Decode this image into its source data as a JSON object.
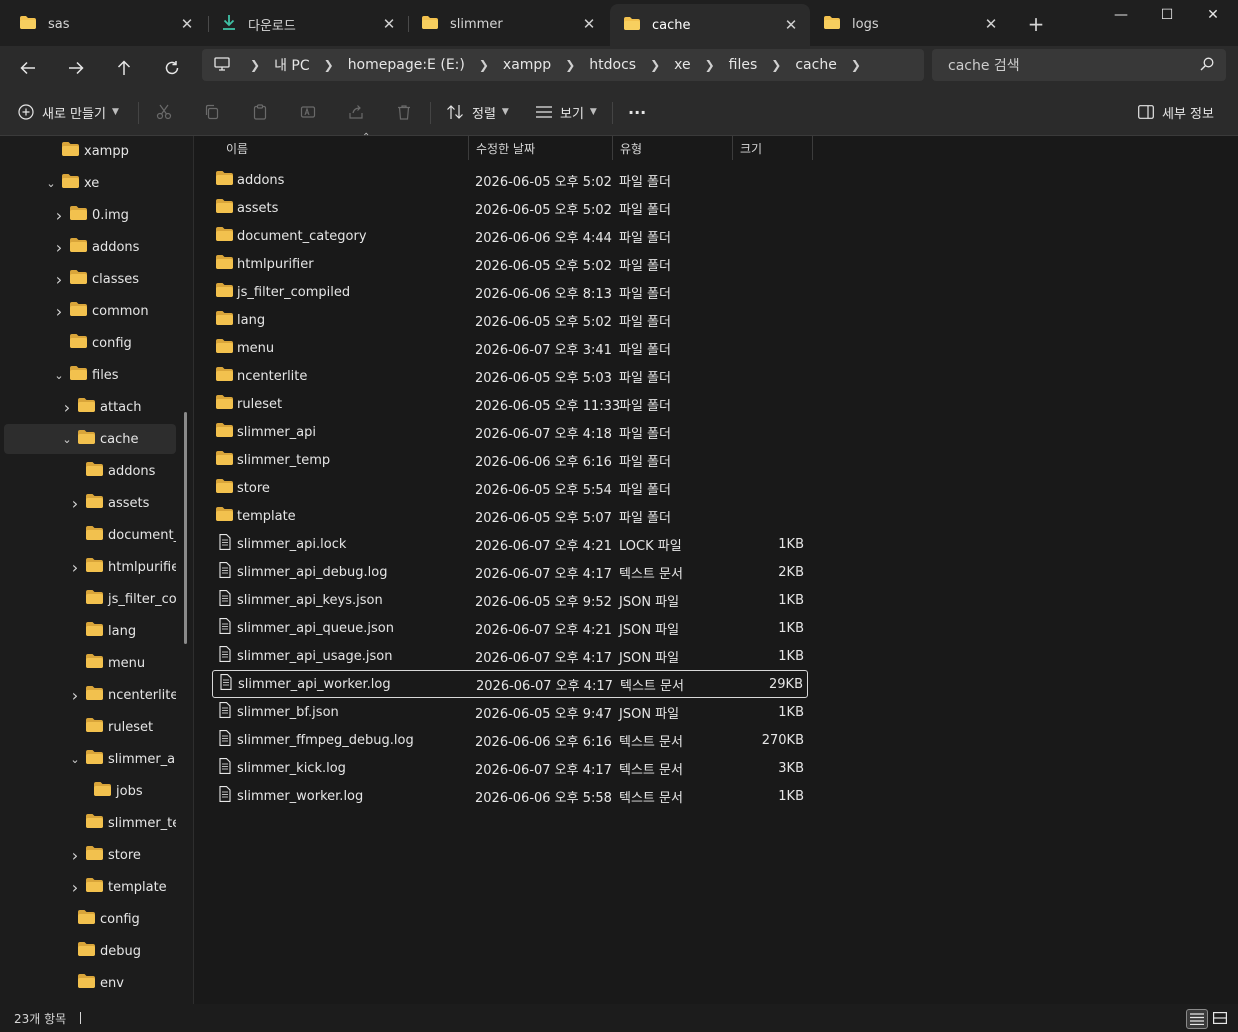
{
  "tabs": [
    {
      "label": "sas",
      "icon": "folder-icon"
    },
    {
      "label": "다운로드",
      "icon": "download-icon"
    },
    {
      "label": "slimmer",
      "icon": "folder-icon"
    },
    {
      "label": "cache",
      "icon": "folder-icon",
      "active": true
    },
    {
      "label": "logs",
      "icon": "folder-icon"
    }
  ],
  "tab_close_glyph": "✕",
  "new_tab_glyph": "+",
  "window_controls": {
    "minimize": "—",
    "maximize": "☐",
    "close": "✕"
  },
  "breadcrumb": [
    "내 PC",
    "homepage:E (E:)",
    "xampp",
    "htdocs",
    "xe",
    "files",
    "cache"
  ],
  "search": {
    "placeholder": "cache 검색"
  },
  "commands": {
    "new": "새로 만들기",
    "sort": "정렬",
    "view": "보기",
    "more": "···",
    "details": "세부 정보"
  },
  "columns": {
    "name": "이름",
    "date": "수정한 날짜",
    "type": "유형",
    "size": "크기"
  },
  "tree": [
    {
      "label": "xampp",
      "depth": 0,
      "chevron": ""
    },
    {
      "label": "xe",
      "depth": 0,
      "chevron": "open"
    },
    {
      "label": "0.img",
      "depth": 1,
      "chevron": "closed"
    },
    {
      "label": "addons",
      "depth": 1,
      "chevron": "closed"
    },
    {
      "label": "classes",
      "depth": 1,
      "chevron": "closed"
    },
    {
      "label": "common",
      "depth": 1,
      "chevron": "closed"
    },
    {
      "label": "config",
      "depth": 1,
      "chevron": ""
    },
    {
      "label": "files",
      "depth": 1,
      "chevron": "open"
    },
    {
      "label": "attach",
      "depth": 2,
      "chevron": "closed"
    },
    {
      "label": "cache",
      "depth": 2,
      "chevron": "open",
      "selected": true
    },
    {
      "label": "addons",
      "depth": 3,
      "chevron": ""
    },
    {
      "label": "assets",
      "depth": 3,
      "chevron": "closed"
    },
    {
      "label": "document_c",
      "depth": 3,
      "chevron": ""
    },
    {
      "label": "htmlpurifier",
      "depth": 3,
      "chevron": "closed"
    },
    {
      "label": "js_filter_com",
      "depth": 3,
      "chevron": ""
    },
    {
      "label": "lang",
      "depth": 3,
      "chevron": ""
    },
    {
      "label": "menu",
      "depth": 3,
      "chevron": ""
    },
    {
      "label": "ncenterlite",
      "depth": 3,
      "chevron": "closed"
    },
    {
      "label": "ruleset",
      "depth": 3,
      "chevron": ""
    },
    {
      "label": "slimmer_api",
      "depth": 3,
      "chevron": "open"
    },
    {
      "label": "jobs",
      "depth": 4,
      "chevron": ""
    },
    {
      "label": "slimmer_ten",
      "depth": 3,
      "chevron": ""
    },
    {
      "label": "store",
      "depth": 3,
      "chevron": "closed"
    },
    {
      "label": "template",
      "depth": 3,
      "chevron": "closed"
    },
    {
      "label": "config",
      "depth": 2,
      "chevron": ""
    },
    {
      "label": "debug",
      "depth": 2,
      "chevron": ""
    },
    {
      "label": "env",
      "depth": 2,
      "chevron": ""
    }
  ],
  "files": [
    {
      "name": "addons",
      "date": "2026-06-05 오후 5:02",
      "type": "파일 폴더",
      "size": "",
      "kind": "folder"
    },
    {
      "name": "assets",
      "date": "2026-06-05 오후 5:02",
      "type": "파일 폴더",
      "size": "",
      "kind": "folder"
    },
    {
      "name": "document_category",
      "date": "2026-06-06 오후 4:44",
      "type": "파일 폴더",
      "size": "",
      "kind": "folder"
    },
    {
      "name": "htmlpurifier",
      "date": "2026-06-05 오후 5:02",
      "type": "파일 폴더",
      "size": "",
      "kind": "folder"
    },
    {
      "name": "js_filter_compiled",
      "date": "2026-06-06 오후 8:13",
      "type": "파일 폴더",
      "size": "",
      "kind": "folder"
    },
    {
      "name": "lang",
      "date": "2026-06-05 오후 5:02",
      "type": "파일 폴더",
      "size": "",
      "kind": "folder"
    },
    {
      "name": "menu",
      "date": "2026-06-07 오후 3:41",
      "type": "파일 폴더",
      "size": "",
      "kind": "folder"
    },
    {
      "name": "ncenterlite",
      "date": "2026-06-05 오후 5:03",
      "type": "파일 폴더",
      "size": "",
      "kind": "folder"
    },
    {
      "name": "ruleset",
      "date": "2026-06-05 오후 11:33",
      "type": "파일 폴더",
      "size": "",
      "kind": "folder"
    },
    {
      "name": "slimmer_api",
      "date": "2026-06-07 오후 4:18",
      "type": "파일 폴더",
      "size": "",
      "kind": "folder"
    },
    {
      "name": "slimmer_temp",
      "date": "2026-06-06 오후 6:16",
      "type": "파일 폴더",
      "size": "",
      "kind": "folder"
    },
    {
      "name": "store",
      "date": "2026-06-05 오후 5:54",
      "type": "파일 폴더",
      "size": "",
      "kind": "folder"
    },
    {
      "name": "template",
      "date": "2026-06-05 오후 5:07",
      "type": "파일 폴더",
      "size": "",
      "kind": "folder"
    },
    {
      "name": "slimmer_api.lock",
      "date": "2026-06-07 오후 4:21",
      "type": "LOCK 파일",
      "size": "1KB",
      "kind": "file"
    },
    {
      "name": "slimmer_api_debug.log",
      "date": "2026-06-07 오후 4:17",
      "type": "텍스트 문서",
      "size": "2KB",
      "kind": "file"
    },
    {
      "name": "slimmer_api_keys.json",
      "date": "2026-06-05 오후 9:52",
      "type": "JSON 파일",
      "size": "1KB",
      "kind": "file"
    },
    {
      "name": "slimmer_api_queue.json",
      "date": "2026-06-07 오후 4:21",
      "type": "JSON 파일",
      "size": "1KB",
      "kind": "file"
    },
    {
      "name": "slimmer_api_usage.json",
      "date": "2026-06-07 오후 4:17",
      "type": "JSON 파일",
      "size": "1KB",
      "kind": "file"
    },
    {
      "name": "slimmer_api_worker.log",
      "date": "2026-06-07 오후 4:17",
      "type": "텍스트 문서",
      "size": "29KB",
      "kind": "file",
      "focused": true
    },
    {
      "name": "slimmer_bf.json",
      "date": "2026-06-05 오후 9:47",
      "type": "JSON 파일",
      "size": "1KB",
      "kind": "file"
    },
    {
      "name": "slimmer_ffmpeg_debug.log",
      "date": "2026-06-06 오후 6:16",
      "type": "텍스트 문서",
      "size": "270KB",
      "kind": "file"
    },
    {
      "name": "slimmer_kick.log",
      "date": "2026-06-07 오후 4:17",
      "type": "텍스트 문서",
      "size": "3KB",
      "kind": "file"
    },
    {
      "name": "slimmer_worker.log",
      "date": "2026-06-06 오후 5:58",
      "type": "텍스트 문서",
      "size": "1KB",
      "kind": "file"
    }
  ],
  "status": {
    "count": "23개 항목"
  },
  "colors": {
    "folder": "#f2c14e",
    "folder_dark": "#d9a53a",
    "accent_download": "#3fc1a5"
  }
}
